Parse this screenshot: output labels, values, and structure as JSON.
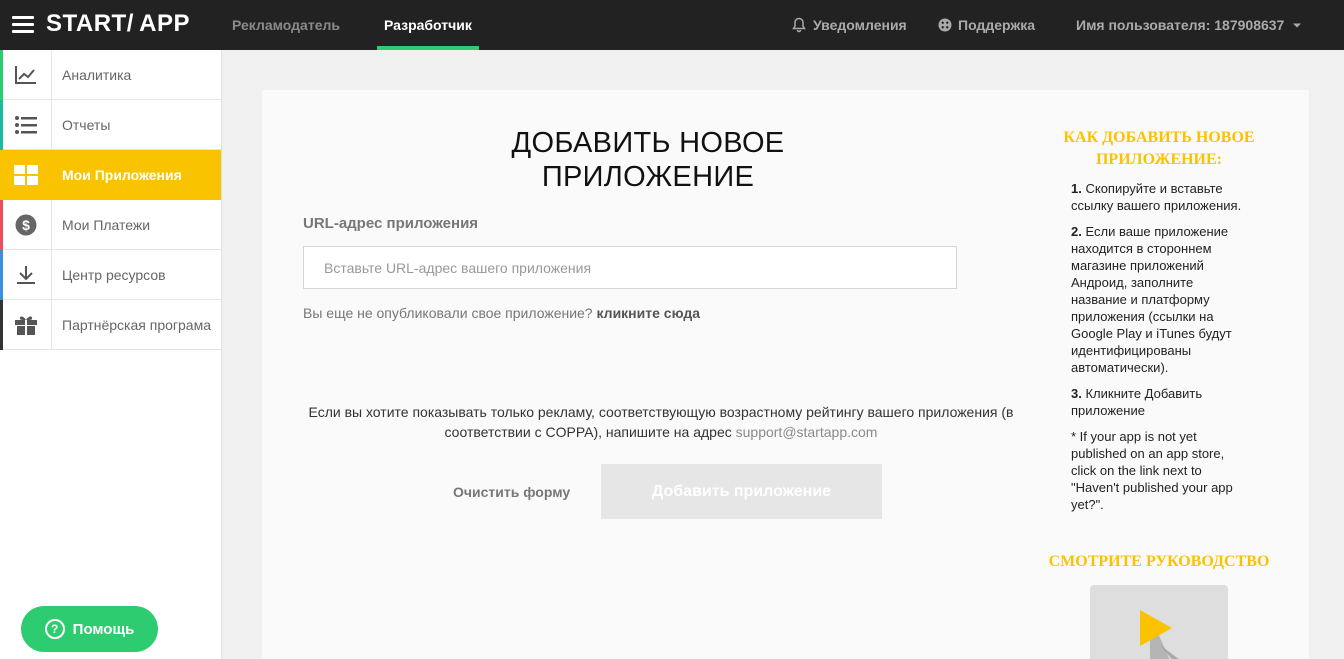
{
  "header": {
    "logo": "START/ APP",
    "tabs": [
      {
        "label": "Рекламодатель"
      },
      {
        "label": "Разработчик"
      }
    ],
    "notifications": "Уведомления",
    "support": "Поддержка",
    "user": "Имя пользователя: 187908637"
  },
  "sidebar": {
    "items": [
      {
        "label": "Аналитика",
        "icon": "chart-line-icon",
        "accent": "#2ecc71"
      },
      {
        "label": "Отчеты",
        "icon": "list-icon",
        "accent": "#1abc9c"
      },
      {
        "label": "Мои Приложения",
        "icon": "grid-icon",
        "accent": "#f9c300"
      },
      {
        "label": "Мои Платежи",
        "icon": "dollar-icon",
        "accent": "#e8505b"
      },
      {
        "label": "Центр ресурсов",
        "icon": "download-icon",
        "accent": "#3a8fd9"
      },
      {
        "label": "Партнёрская програма",
        "icon": "gift-icon",
        "accent": "#333333"
      }
    ],
    "help": "Помощь"
  },
  "main": {
    "title_line1": "ДОБАВИТЬ НОВОЕ",
    "title_line2": "ПРИЛОЖЕНИЕ",
    "url_label": "URL-адрес приложения",
    "url_placeholder": "Вставьте URL-адрес вашего приложения",
    "url_value": "",
    "not_published_text": "Вы еще не опубликовали свое приложение?",
    "not_published_link": "кликните сюда",
    "coppa_text": "Если вы хотите показывать только рекламу, соответствующую возрастному рейтингу вашего приложения (в соответствии с COPPA), напишите на адрес",
    "coppa_email": "support@startapp.com",
    "clear_button": "Очистить форму",
    "add_button": "Добавить приложение"
  },
  "instructions": {
    "title": "КАК ДОБАВИТЬ НОВОЕ ПРИЛОЖЕНИЕ:",
    "steps": [
      {
        "num": "1.",
        "text": "Скопируйте и вставьте ссылку вашего приложения."
      },
      {
        "num": "2.",
        "text": "Если ваше приложение находится в стороннем магазине приложений Андроид, заполните название и платформу приложения (ссылки на Google Play и iTunes будут идентифицированы автоматически)."
      },
      {
        "num": "3.",
        "text": "Кликните Добавить приложение"
      }
    ],
    "note": "* If your app is not yet published on an app store, click on the link next to \"Haven't published your app yet?\".",
    "guide_title": "СМОТРИТЕ РУКОВОДСТВО"
  },
  "colors": {
    "accent_yellow": "#f9c300",
    "accent_green": "#2ecc71",
    "topbar": "#222222"
  }
}
